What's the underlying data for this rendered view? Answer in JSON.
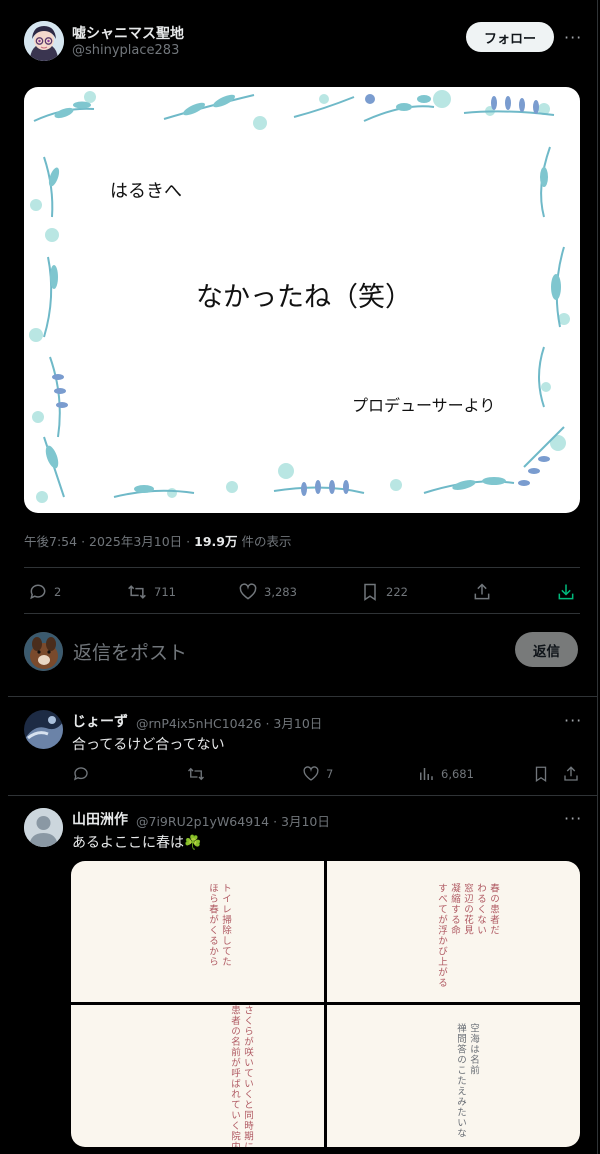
{
  "post": {
    "author": {
      "name": "嘘シャニマス聖地",
      "handle": "@shinyplace283"
    },
    "follow_label": "フォロー",
    "card": {
      "to": "はるきへ",
      "message": "なかったね（笑）",
      "from": "プロデューサーより"
    },
    "time": "午後7:54",
    "date": "2025年3月10日",
    "views_count": "19.9万",
    "views_label": "件の表示",
    "actions": {
      "replies": "2",
      "reposts": "711",
      "likes": "3,283",
      "bookmarks": "222"
    }
  },
  "composer": {
    "placeholder": "返信をポスト",
    "button_label": "返信"
  },
  "replies": [
    {
      "name": "じょーず",
      "handle": "@rnP4ix5nHC10426",
      "date": "3月10日",
      "text": "合ってるけど合ってない",
      "likes": "7",
      "views": "6,681"
    },
    {
      "name": "山田洲作",
      "handle": "@7i9RU2p1yW64914",
      "date": "3月10日",
      "text": "あるよここに春は☘️",
      "panels": [
        "トイレ掃除してた\nほら春がくるから",
        "春の患者だ\nわるくない\n窓辺の花見\n凝縮する命\nすべてが浮かび上がる",
        "さくらが咲いていくと同時期に\n患者の名前が呼ばれていく院内",
        "空海は名前\n禅問答のこたえみたいな"
      ]
    }
  ],
  "colors": {
    "bg": "#000000",
    "text": "#e7e9ea",
    "muted": "#71767b",
    "border": "#2f3336",
    "download": "#00ba7c",
    "panel_text_red": "#b05a63",
    "panel_text_gray": "#6a6f76"
  }
}
